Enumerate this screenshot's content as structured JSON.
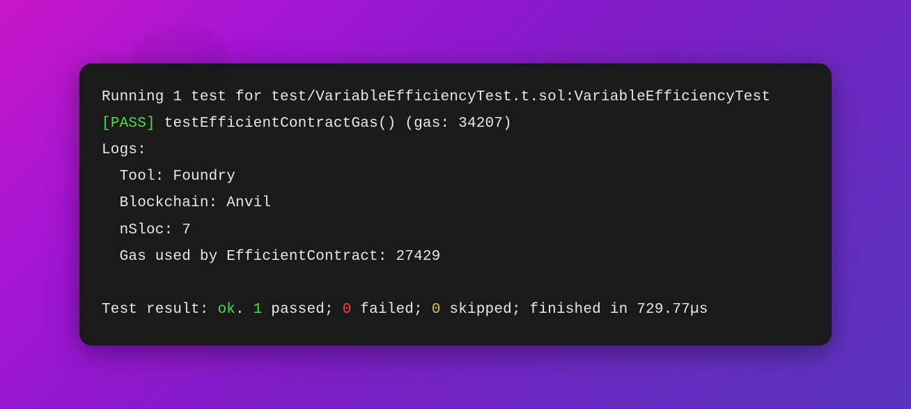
{
  "terminal": {
    "running_line": "Running 1 test for test/VariableEfficiencyTest.t.sol:VariableEfficiencyTest",
    "pass_bracket_open": "[",
    "pass_label": "PASS",
    "pass_bracket_close": "]",
    "test_name_line": " testEfficientContractGas() (gas: 34207)",
    "logs_label": "Logs:",
    "logs": {
      "tool": "  Tool: Foundry",
      "blockchain": "  Blockchain: Anvil",
      "nsloc": "  nSloc: 7",
      "gas_used": "  Gas used by EfficientContract: 27429"
    },
    "result": {
      "prefix": "Test result: ",
      "ok": "ok",
      "after_ok": ". ",
      "passed_count": "1",
      "passed_label": " passed; ",
      "failed_count": "0",
      "failed_label": " failed; ",
      "skipped_count": "0",
      "skipped_label": " skipped; finished in 729.77µs"
    }
  }
}
